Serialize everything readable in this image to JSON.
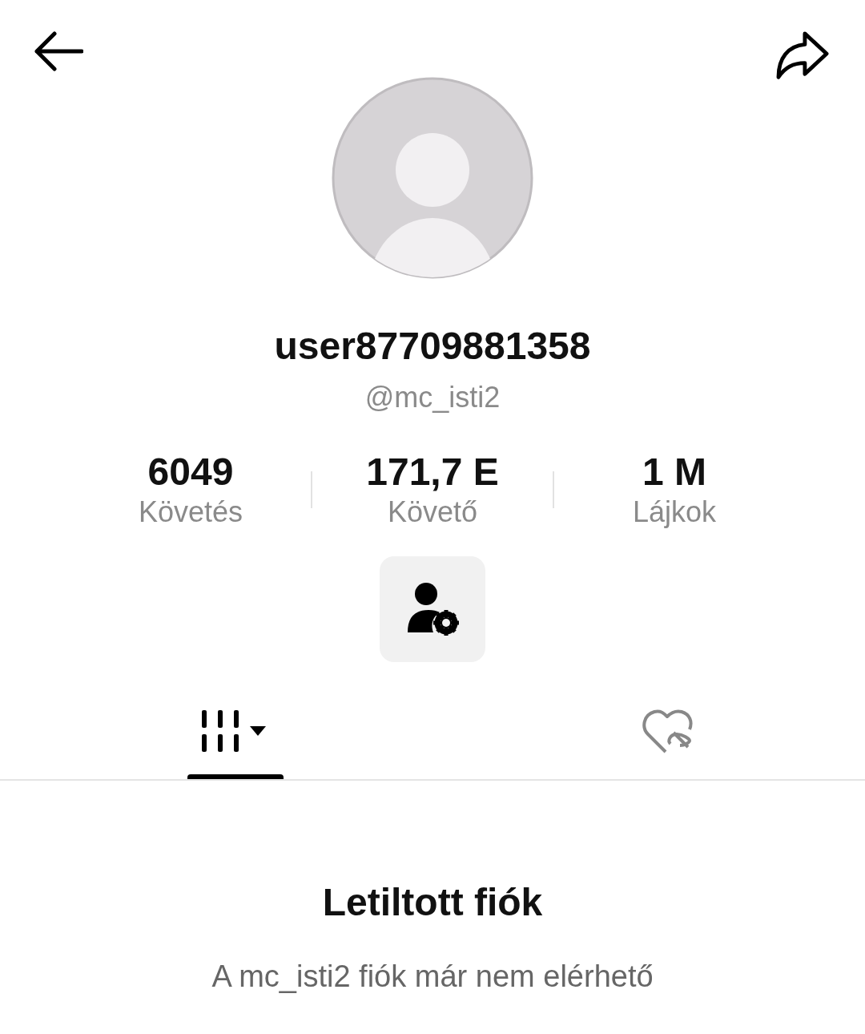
{
  "profile": {
    "display_name": "user87709881358",
    "handle": "@mc_isti2"
  },
  "stats": [
    {
      "value": "6049",
      "label": "Követés"
    },
    {
      "value": "171,7 E",
      "label": "Követő"
    },
    {
      "value": "1 M",
      "label": "Lájkok"
    }
  ],
  "tabs": [
    {
      "kind": "videos",
      "selected": true
    },
    {
      "kind": "liked",
      "selected": false
    }
  ],
  "notice": {
    "title": "Letiltott fiók",
    "message": "A mc_isti2 fiók már nem elérhető"
  }
}
